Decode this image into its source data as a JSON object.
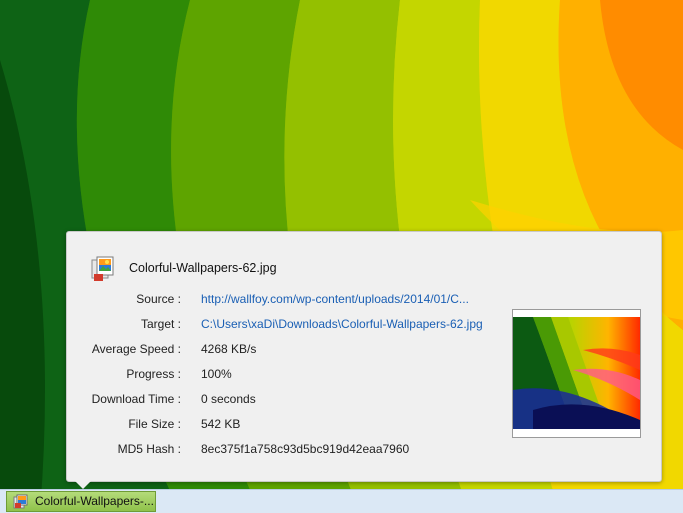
{
  "popup": {
    "file_name": "Colorful-Wallpapers-62.jpg",
    "icon": "image-file-icon",
    "rows": [
      {
        "label": "Source :",
        "value": "http://wallfoy.com/wp-content/uploads/2014/01/C...",
        "link": true
      },
      {
        "label": "Target :",
        "value": "C:\\Users\\xaDi\\Downloads\\Colorful-Wallpapers-62.jpg",
        "link": true
      },
      {
        "label": "Average Speed :",
        "value": "4268 KB/s",
        "link": false
      },
      {
        "label": "Progress :",
        "value": "100%",
        "link": false
      },
      {
        "label": "Download Time :",
        "value": "0 seconds",
        "link": false
      },
      {
        "label": "File Size :",
        "value": "542 KB",
        "link": false
      },
      {
        "label": "MD5 Hash :",
        "value": "8ec375f1a758c93d5bc919d42eaa7960",
        "link": false
      }
    ]
  },
  "taskbar": {
    "item_label": "Colorful-Wallpapers-...",
    "item_icon": "image-file-icon"
  },
  "colors": {
    "link": "#1a5fb4",
    "popup_bg": "#f0f0f0",
    "taskbar_bg": "#dbe8f5",
    "task_item": "#9fcd5c"
  }
}
